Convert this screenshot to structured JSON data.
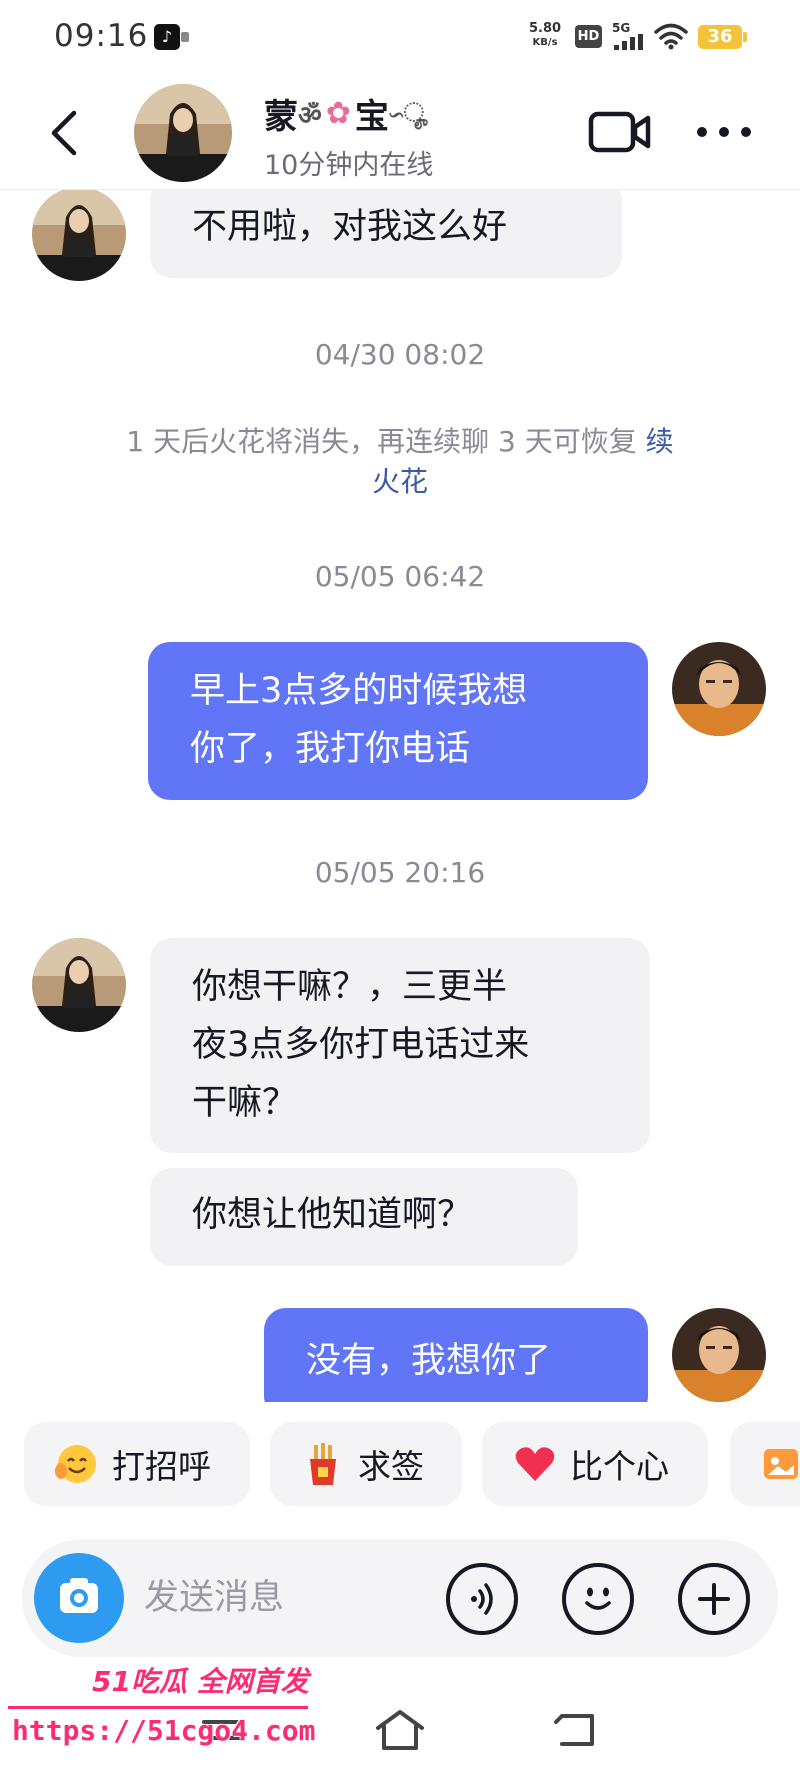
{
  "status_bar": {
    "time": "09:16",
    "net_speed_value": "5.80",
    "net_speed_unit": "KB/s",
    "hd_label": "HD",
    "signal_label": "5G",
    "battery_level": "36"
  },
  "header": {
    "contact_name": "蒙",
    "contact_name_end": "宝",
    "online_status": "10分钟内在线"
  },
  "messages": [
    {
      "text": "不用啦，对我这么好"
    },
    {
      "timestamp": "04/30 08:02"
    },
    {
      "system_text": "1 天后火花将消失，再连续聊 3 天可恢复",
      "system_link": "续火花"
    },
    {
      "timestamp": "05/05 06:42"
    },
    {
      "text_line1": "早上3点多的时候我想",
      "text_line2": "你了，我打你电话"
    },
    {
      "timestamp": "05/05 20:16"
    },
    {
      "text_line1": "你想干嘛？，三更半",
      "text_line2": "夜3点多你打电话过来",
      "text_line3": "干嘛？"
    },
    {
      "text": "你想让他知道啊？"
    },
    {
      "text": "没有，我想你了"
    }
  ],
  "quick_replies": [
    {
      "label": "打招呼",
      "icon": "smiley-wave-icon"
    },
    {
      "label": "求签",
      "icon": "fortune-sticks-icon"
    },
    {
      "label": "比个心",
      "icon": "heart-icon"
    },
    {
      "label": "",
      "icon": "image-gallery-icon"
    }
  ],
  "input": {
    "placeholder": "发送消息"
  },
  "watermark": {
    "brand": "51吃瓜 全网首发",
    "url": "https://51cgo4.com"
  },
  "colors": {
    "outgoing_bubble": "#6175f7",
    "incoming_bubble": "#f2f2f4",
    "camera_button": "#2d9bf0",
    "battery": "#f5c33b",
    "watermark": "#ff2a74"
  }
}
